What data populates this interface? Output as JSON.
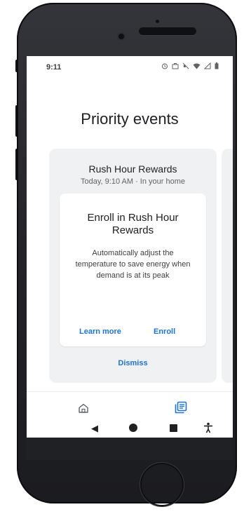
{
  "status_bar": {
    "time": "9:11",
    "icons": [
      "alarm-icon",
      "work-icon",
      "mute-icon",
      "wifi-icon",
      "signal-icon",
      "battery-icon"
    ]
  },
  "header": {
    "title": "Priority events"
  },
  "card": {
    "title": "Rush Hour Rewards",
    "subtitle": "Today, 9:10 AM · In your home",
    "inner": {
      "title": "Enroll in Rush Hour Rewards",
      "body": "Automatically adjust the temperature to save energy when demand is at its peak",
      "learn_more": "Learn more",
      "enroll": "Enroll"
    },
    "dismiss": "Dismiss"
  },
  "bottom_nav": {
    "items": [
      "home-icon",
      "feed-icon"
    ]
  },
  "system_nav": {
    "items": [
      "back-icon",
      "home-circle-icon",
      "recents-icon",
      "accessibility-icon"
    ]
  },
  "colors": {
    "accent": "#1a73e8",
    "card_bg": "#eff1f3",
    "text": "#202124",
    "subtext": "#5f6368"
  }
}
